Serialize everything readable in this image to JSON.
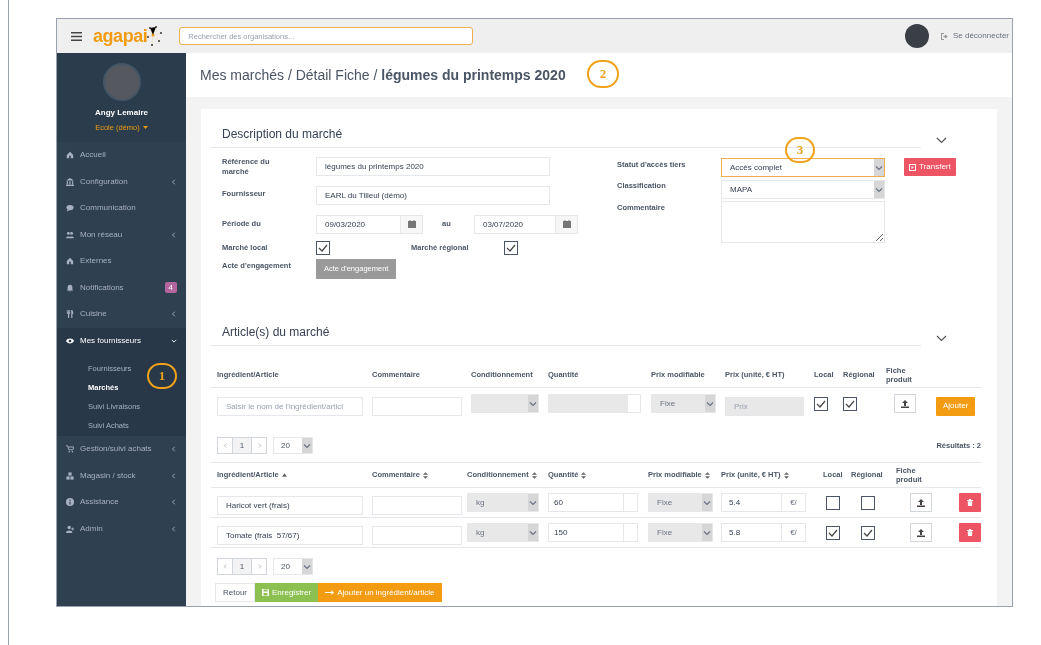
{
  "topbar": {
    "logo": "agapai",
    "search_placeholder": "Rechercher des organisations...",
    "logout": "Se déconnecter"
  },
  "sidebar": {
    "user_name": "Angy Lemaire",
    "user_org": "Ecole (démo)",
    "items": [
      {
        "label": "Accueil"
      },
      {
        "label": "Configuration",
        "expanded": false
      },
      {
        "label": "Communication"
      },
      {
        "label": "Mon réseau",
        "expanded": false
      },
      {
        "label": "Externes"
      },
      {
        "label": "Notifications",
        "badge": "4"
      },
      {
        "label": "Cuisine",
        "expanded": false
      },
      {
        "label": "Mes fournisseurs",
        "expanded": true,
        "children": [
          {
            "label": "Fournisseurs",
            "selected": false
          },
          {
            "label": "Marchés",
            "selected": true
          },
          {
            "label": "Suivi Livraisons",
            "selected": false
          },
          {
            "label": "Suivi Achats",
            "selected": false
          }
        ]
      },
      {
        "label": "Gestion/suivi achats",
        "expanded": false
      },
      {
        "label": "Magasin / stock",
        "expanded": false
      },
      {
        "label": "Assistance",
        "expanded": false
      },
      {
        "label": "Admin",
        "expanded": false
      }
    ]
  },
  "breadcrumb": "Mes marchés / Détail Fiche / **légumes du printemps 2020**",
  "description": {
    "title": "Description du marché",
    "reference_label": "Référence du marché",
    "reference": "légumes du printemps 2020",
    "supplier_label": "Fournisseur",
    "supplier": "EARL du Tilleul (démo)",
    "period_label": "Période du",
    "period_from": "09/03/2020",
    "period_to_label": "au",
    "period_to": "03/07/2020",
    "local_label": "Marché local",
    "local": true,
    "regional_label": "Marché régional",
    "regional": true,
    "commitment_label": "Acte d'engagement",
    "commitment_button": "Acte d'engagement",
    "access_label": "Statut d'accès tiers",
    "access": "Accès complet",
    "transfer_button": "Transfert",
    "classification_label": "Classification",
    "classification": "MAPA",
    "comment_label": "Commentaire"
  },
  "articles": {
    "title": "Article(s) du marché",
    "new_columns": [
      "Ingrédient/Article",
      "Commentaire",
      "Conditionnement",
      "Quantité",
      "Prix modifiable",
      "Prix (unité, € HT)",
      "Local",
      "Régional",
      "Fiche produit"
    ],
    "new_row": {
      "ingredient_placeholder": "Saisir le nom de l'ingrédient/articl",
      "price_mode": "Fixe",
      "price_placeholder": "Prix",
      "local": true,
      "regional": true,
      "add_button": "Ajouter"
    },
    "pager": {
      "page": "1",
      "page_size": "20"
    },
    "results": "Résultats : 2",
    "columns": [
      {
        "label": "Ingrédient/Article",
        "sorted_ascending": true
      },
      {
        "label": "Commentaire",
        "sortable": true
      },
      {
        "label": "Conditionnement",
        "sortable": true
      },
      {
        "label": "Quantité",
        "sortable": true
      },
      {
        "label": "Prix modifiable",
        "sortable": true
      },
      {
        "label": "Prix (unité, € HT)",
        "sortable": true
      },
      {
        "label": "Local"
      },
      {
        "label": "Régional"
      },
      {
        "label": "Fiche produit"
      }
    ],
    "rows": [
      {
        "ingredient": "Haricot vert (frais)",
        "packaging": "kg",
        "quantity": "60",
        "price_mode": "Fixe",
        "price": "5.4",
        "price_unit": "€/",
        "local": false,
        "regional": false
      },
      {
        "ingredient": "Tomate (frais  57/67)",
        "packaging": "kg",
        "quantity": "150",
        "price_mode": "Fixe",
        "price": "5.8",
        "price_unit": "€/",
        "local": true,
        "regional": true
      }
    ],
    "pager_bottom": {
      "page": "1",
      "page_size": "20"
    }
  },
  "footer_buttons": [
    {
      "label": "Retour",
      "kind": "default"
    },
    {
      "label": "Enregistrer",
      "kind": "save"
    },
    {
      "label": "Ajouter un ingrédient/article",
      "kind": "add"
    }
  ],
  "callouts": [
    "1",
    "2",
    "3"
  ]
}
